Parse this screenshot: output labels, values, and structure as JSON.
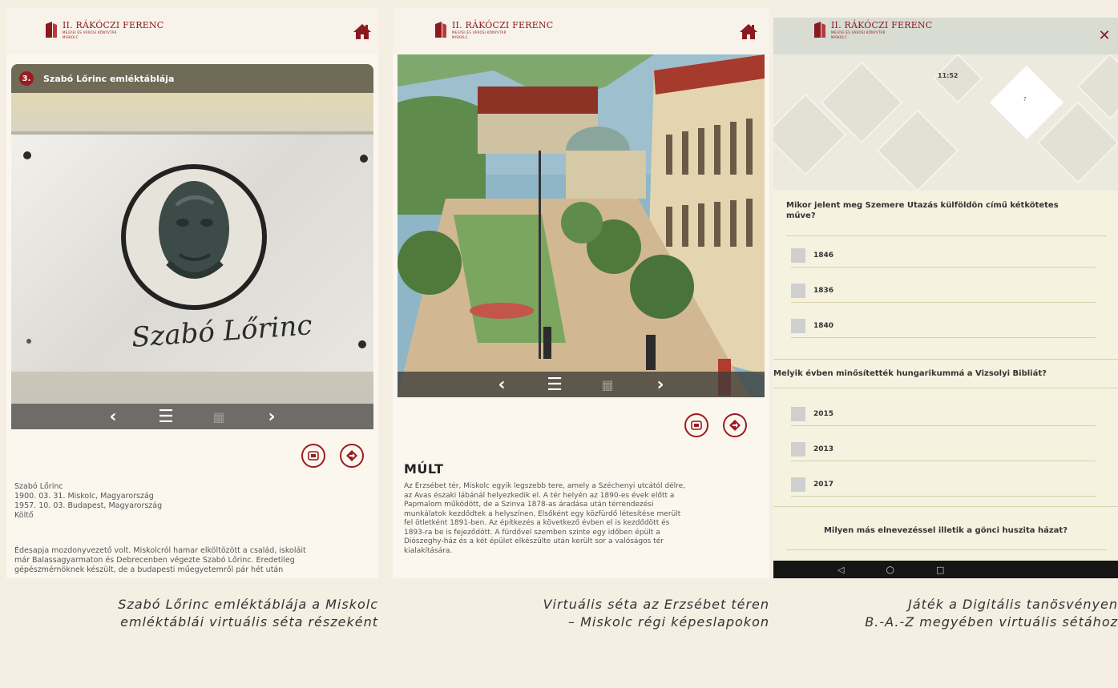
{
  "brand": {
    "title": "II. RÁKÓCZI FERENC",
    "subtitle": "MEGYEI ÉS VÁROSI KÖNYVTÁR",
    "city": "MISKOLC"
  },
  "screen1": {
    "badge": "3.",
    "title": "Szabó Lőrinc emléktáblája",
    "signature": "Szabó Lőrinc",
    "nav": {
      "prev": "‹",
      "list": "☰",
      "map": "▦",
      "next": "›"
    },
    "info_lines": [
      "Szabó Lőrinc",
      "1900. 03. 31. Miskolc, Magyarország",
      "1957. 10. 03. Budapest, Magyarország",
      "Költő"
    ],
    "body_lines": [
      "Édesapja mozdonyvezető volt. Miskolcról hamar elköltözött a család, iskoláit",
      "már Balassagyarmaton és Debrecenben végezte Szabó Lőrinc. Eredetileg",
      "gépészmérnöknek készült, de a budapesti műegyetemről pár hét után"
    ]
  },
  "screen2": {
    "nav": {
      "prev": "‹",
      "list": "☰",
      "map": "▦",
      "next": "›"
    },
    "heading": "MÚLT",
    "body_lines": [
      "Az Erzsébet tér, Miskolc egyik legszebb tere, amely a Széchenyi utcától délre,",
      "az Avas északi lábánál helyezkedik el. A tér helyén az 1890-es évek előtt a",
      "Papmalom működött, de a Szinva 1878-as áradása után térrendezési",
      "munkálatok kezdődtek a helyszínen. Elsőként egy közfürdő létesítése merült",
      "fel ötletként 1891-ben. Az építkezés a következő évben el is kezdődött és",
      "1893-ra be is fejeződött. A fürdővel szemben szinte egy időben épült a",
      "Diószeghy-ház és a két épület elkészülte után került sor a valóságos tér",
      "kialakítására."
    ]
  },
  "screen3": {
    "close": "✕",
    "timer": "11:52",
    "diamond_mark": "?",
    "questions": [
      {
        "text_line1": "Mikor jelent meg Szemere Utazás külföldön című kétkötetes",
        "text_line2": "műve?",
        "answers": [
          "1846",
          "1836",
          "1840"
        ]
      },
      {
        "text_line1": "Melyik évben minősítették hungarikummá a Vizsolyi Bibliát?",
        "answers": [
          "2015",
          "2013",
          "2017"
        ]
      },
      {
        "text_line1": "Milyen más elnevezéssel illetik a gönci huszita házat?"
      }
    ],
    "android": {
      "back": "◁",
      "home": "○",
      "recent": "□"
    }
  },
  "captions": {
    "c1_line1": "Szabó Lőrinc emléktáblája a Miskolc",
    "c1_line2": "emléktáblái virtuális séta részeként",
    "c2_line1": "Virtuális séta az Erzsébet téren",
    "c2_line2": "– Miskolc régi képeslapokon",
    "c3_line1": "Játék a Digitális tanösvényen",
    "c3_line2": "B.-A.-Z megyében virtuális sétához"
  },
  "colors": {
    "accent": "#9a1c22",
    "header": "#706b57",
    "navbar": "#6e6c66",
    "background": "#f4eee3"
  }
}
